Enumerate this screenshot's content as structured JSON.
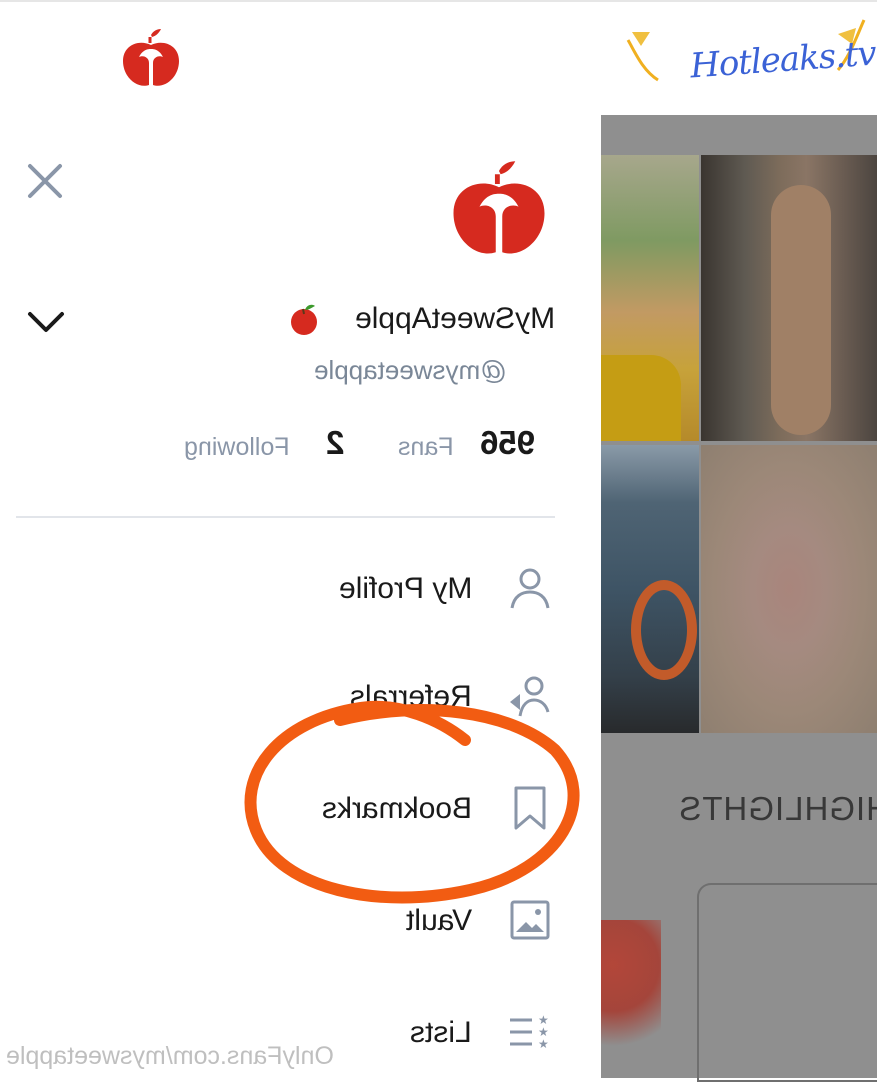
{
  "topbar": {
    "logo_icon": "apple-logo-icon"
  },
  "watermark": {
    "text": "Hotleaks.tv"
  },
  "drawer": {
    "close_icon": "close-icon",
    "profile": {
      "display_name": "MySweetApple",
      "badge_icon": "apple-emoji-icon",
      "handle": "@mysweetapple",
      "fans_count": "956",
      "fans_label": "Fans",
      "following_count": "2",
      "following_label": "Following"
    },
    "menu": [
      {
        "label": "My Profile",
        "icon": "user-icon"
      },
      {
        "label": "Referrals",
        "icon": "referral-user-icon"
      },
      {
        "label": "Bookmarks",
        "icon": "bookmark-icon"
      },
      {
        "label": "Vault",
        "icon": "image-icon"
      },
      {
        "label": "Lists",
        "icon": "star-list-icon"
      }
    ]
  },
  "background": {
    "section_title": "HIGHLIGHTS"
  },
  "footer": {
    "watermark": "OnlyFans.com/mysweetapple"
  },
  "colors": {
    "brand_red": "#d62a1f",
    "annotation_orange": "#f25c12",
    "muted_text": "#8a96a8"
  }
}
